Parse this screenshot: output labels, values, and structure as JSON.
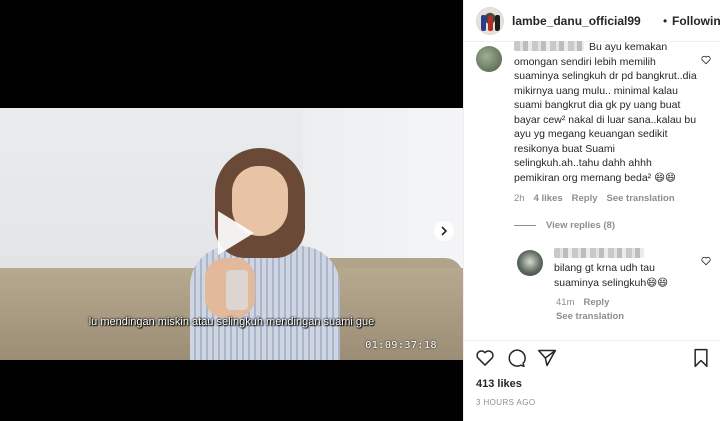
{
  "post": {
    "username": "lambe_danu_official99",
    "separator": "•",
    "follow_label": "Following",
    "likes": "413 likes",
    "time": "3 HOURS AGO"
  },
  "video": {
    "subtitle": "lu mendingan miskin atau selingkuh mendingan suami gue",
    "timestamp": "01:09:37:18",
    "play_icon": "play-icon"
  },
  "comments": [
    {
      "text": "Bu ayu kemakan omongan sendiri lebih memilih suaminya selingkuh dr pd bangkrut..dia mikirnya uang mulu.. minimal kalau suami bangkrut dia gk py uang buat bayar cew² nakal di luar sana..kalau bu ayu yg megang keuangan sedikit resikonya buat Suami selingkuh.ah..tahu dahh ahhh pemikiran org memang beda² 😄😄",
      "age": "2h",
      "likes": "4 likes",
      "reply": "Reply",
      "translate": "See translation",
      "view_replies": "View replies (8)"
    },
    {
      "text": "bilang gt krna udh tau suaminya selingkuh😄😄",
      "age": "41m",
      "reply": "Reply",
      "translate": "See translation"
    }
  ]
}
